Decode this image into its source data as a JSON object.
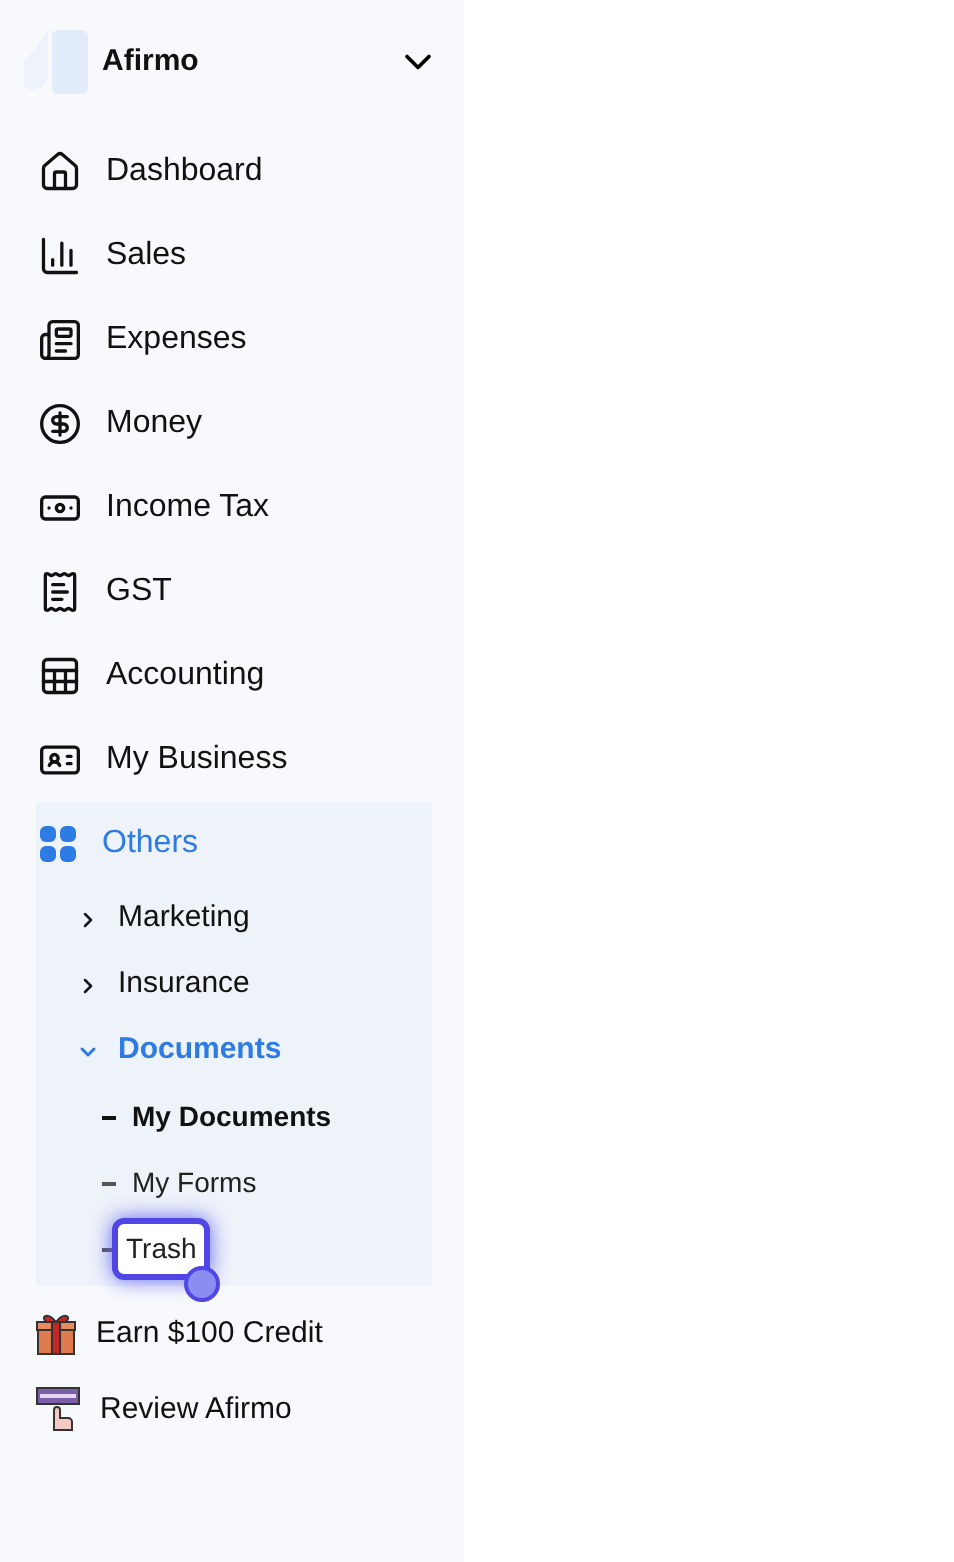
{
  "brand": {
    "name": "Afirmo"
  },
  "nav": [
    {
      "label": "Dashboard",
      "selected": false
    },
    {
      "label": "Sales",
      "selected": false
    },
    {
      "label": "Expenses",
      "selected": false
    },
    {
      "label": "Money",
      "selected": false
    },
    {
      "label": "Income Tax",
      "selected": false
    },
    {
      "label": "GST",
      "selected": false
    },
    {
      "label": "Accounting",
      "selected": false
    },
    {
      "label": "My Business",
      "selected": false
    },
    {
      "label": "Others",
      "selected": true,
      "children": [
        {
          "label": "Marketing",
          "expanded": false
        },
        {
          "label": "Insurance",
          "expanded": false
        },
        {
          "label": "Documents",
          "expanded": true,
          "children": [
            {
              "label": "My Documents",
              "selected": true,
              "highlighted": false
            },
            {
              "label": "My Forms",
              "selected": false,
              "highlighted": false
            },
            {
              "label": "Trash",
              "selected": false,
              "highlighted": true
            }
          ]
        }
      ]
    }
  ],
  "footer": [
    {
      "label": "Earn $100 Credit"
    },
    {
      "label": "Review Afirmo"
    }
  ]
}
